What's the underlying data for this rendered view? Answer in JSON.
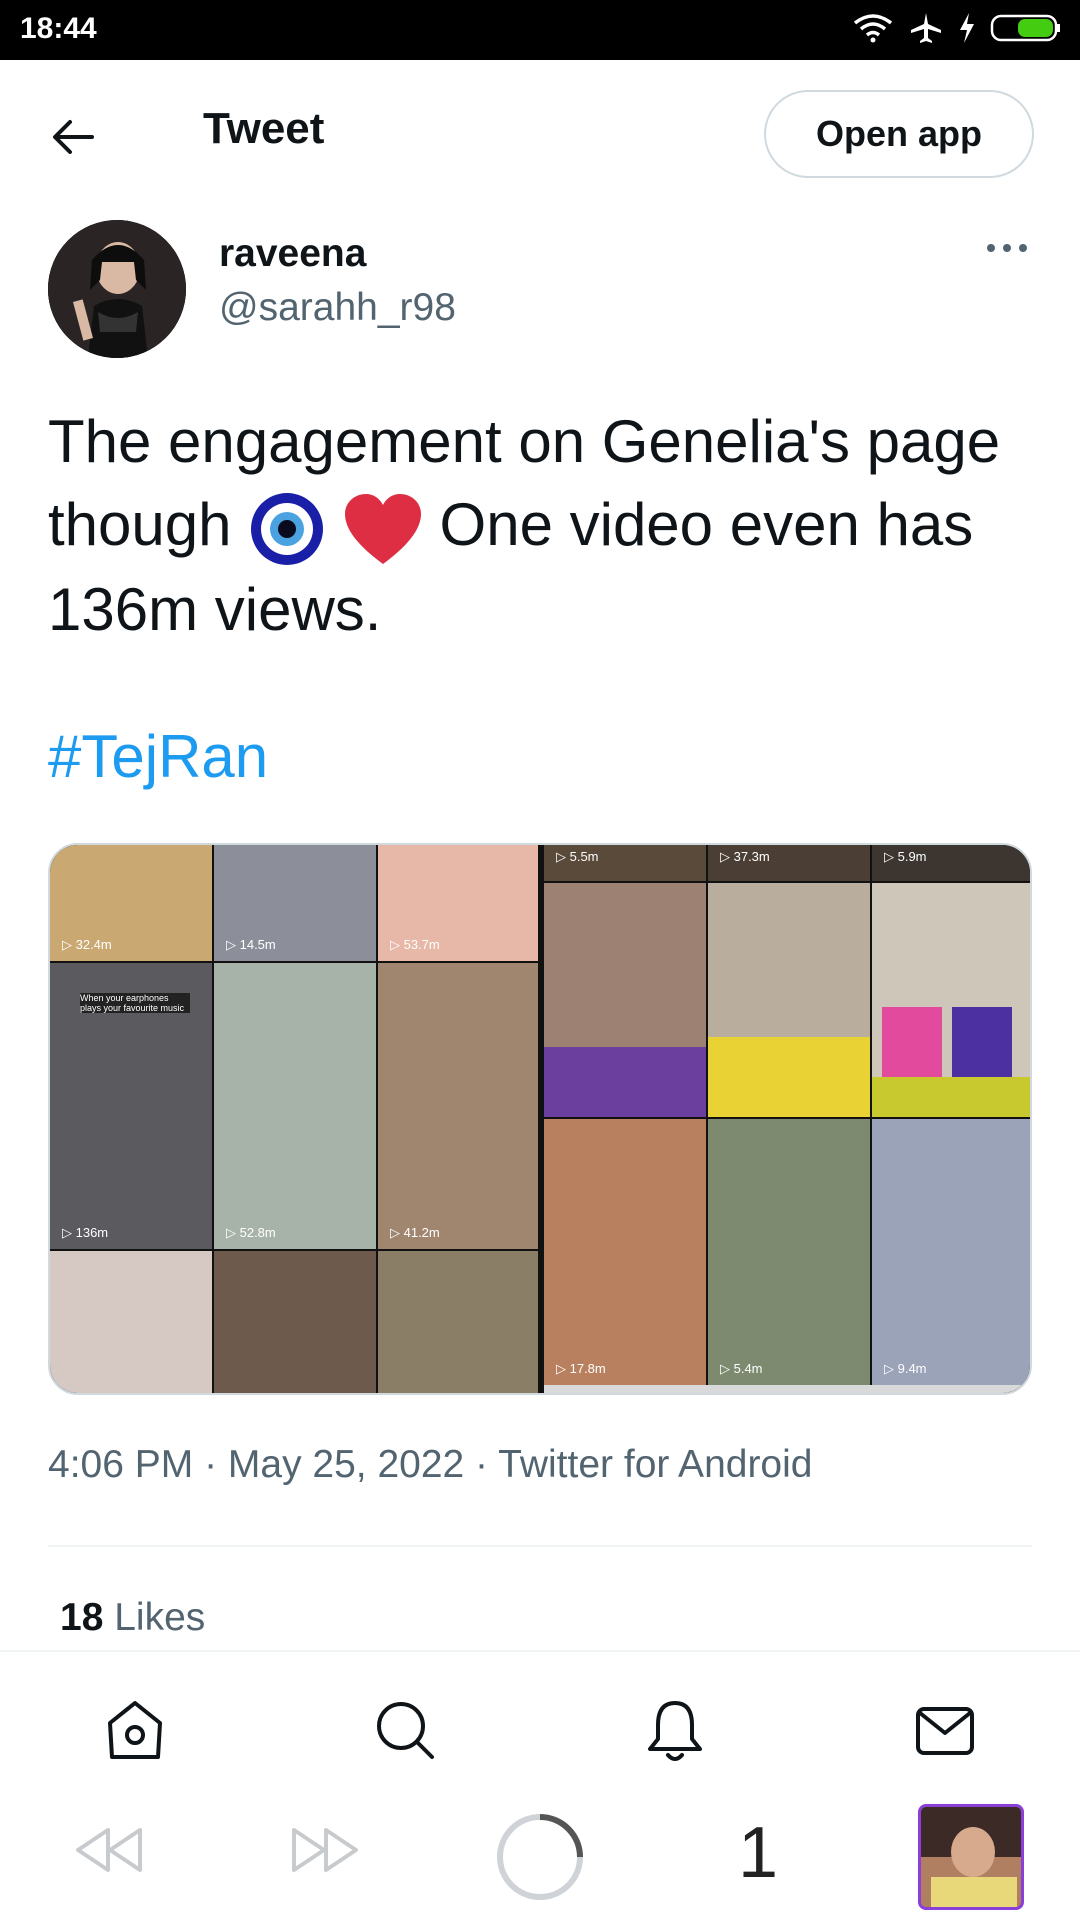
{
  "status_bar": {
    "time": "18:44",
    "icons": [
      "wifi-icon",
      "airplane-icon",
      "charging-icon",
      "battery-icon"
    ],
    "battery_color": "#44cc11"
  },
  "header": {
    "title": "Tweet",
    "open_app_label": "Open app"
  },
  "tweet": {
    "author_name": "raveena",
    "author_handle": "@sarahh_r98",
    "text_part1": "The engagement on Genelia's page though",
    "text_part2": "One video even has 136m views.",
    "emojis": [
      "nazar-amulet-emoji",
      "red-heart-emoji"
    ],
    "hashtag": "#TejRan",
    "meta": "4:06 PM · May 25, 2022 · Twitter for Android",
    "likes_count": "18",
    "likes_label": "Likes"
  },
  "media": {
    "left_grid_labels": [
      "32.4m",
      "14.5m",
      "53.7m",
      "136m",
      "52.8m",
      "41.2m"
    ],
    "left_caption": "When your earphones plays your favourite music",
    "right_top_labels": [
      "5.5m",
      "37.3m",
      "5.9m"
    ],
    "right_bottom_labels": [
      "17.8m",
      "5.4m",
      "9.4m"
    ]
  },
  "bottom_nav": {
    "items": [
      "home-icon",
      "search-icon",
      "notifications-icon",
      "messages-icon"
    ]
  },
  "system_bar": {
    "tab_count": "1"
  },
  "colors": {
    "accent": "#1d9bf0",
    "text": "#0f1419",
    "secondary": "#536471"
  }
}
